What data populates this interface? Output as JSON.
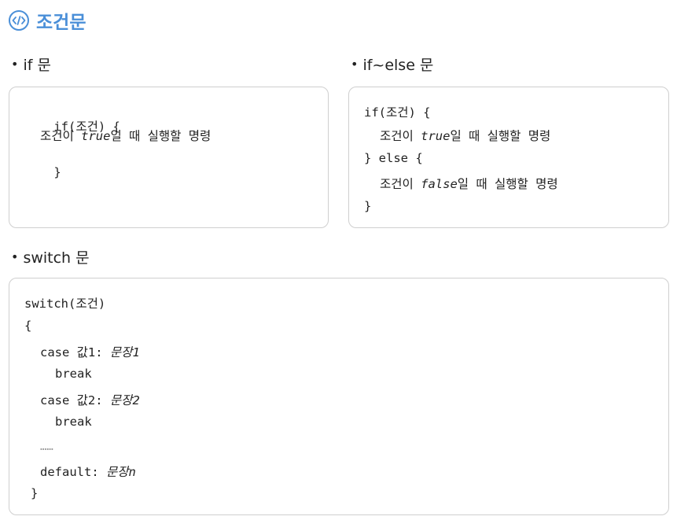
{
  "header": {
    "title": "조건문",
    "icon": "code-circle-icon",
    "accent": "#4a8fd8"
  },
  "sections": {
    "if": {
      "label": "if 문",
      "lines": [
        {
          "text": "if(조건) {"
        },
        {
          "text": "조건이 ",
          "em": "true",
          "rest": "일 때 실행할 명령"
        },
        {
          "text": "}"
        }
      ]
    },
    "ifelse": {
      "label": "if~else 문",
      "lines": [
        {
          "text": "if(조건) {"
        },
        {
          "text": "조건이 ",
          "em": "true",
          "rest": "일 때 실행할 명령"
        },
        {
          "text": "} else {"
        },
        {
          "text": "조건이 ",
          "em": "false",
          "rest": "일 때 실행할 명령"
        },
        {
          "text": "}"
        }
      ]
    },
    "switch": {
      "label": "switch 문",
      "lines": [
        {
          "text": "switch(조건)"
        },
        {
          "text": "{"
        },
        {
          "text": "case 값1: ",
          "em": "문장1"
        },
        {
          "text": "break"
        },
        {
          "text": "case 값2: ",
          "em": "문장2"
        },
        {
          "text": "break"
        },
        {
          "text": "……"
        },
        {
          "text": "default: ",
          "em": "문장n"
        },
        {
          "text": "}"
        }
      ]
    }
  }
}
